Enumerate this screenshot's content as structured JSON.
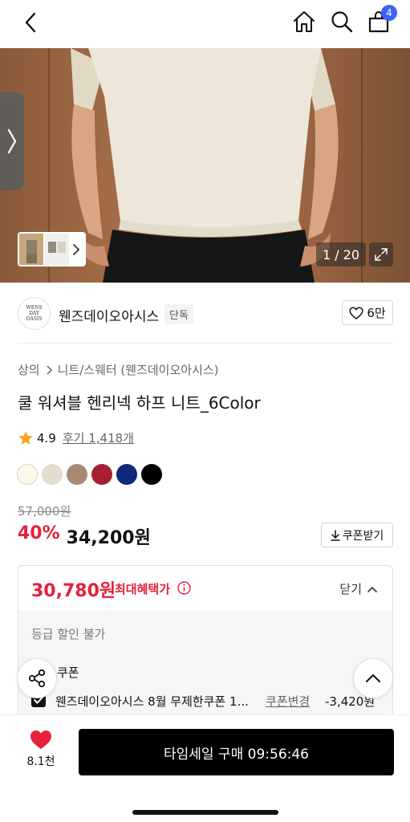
{
  "header": {
    "cart_count": "4",
    "icons": [
      "back-icon",
      "home-icon",
      "search-icon",
      "bag-icon"
    ]
  },
  "gallery": {
    "counter": "1 / 20",
    "colors": {
      "wall": "#a06a45",
      "shirt": "#ebe6d8",
      "pants": "#1a1a1a"
    }
  },
  "brand": {
    "logo_text": "WENS DAY OASIS",
    "name": "웬즈데이오아시스",
    "tag": "단독",
    "likes": "6만"
  },
  "product": {
    "breadcrumb": [
      "상의",
      "니트/스웨터 (웬즈데이오아시스)"
    ],
    "title": "쿨 워셔블 헨리넥 하프 니트_6Color",
    "rating": "4.9",
    "reviews": "후기 1,418개",
    "swatches": [
      "#fbfae8",
      "#e4ddcc",
      "#a68b73",
      "#a81f35",
      "#0e2a78",
      "#000000"
    ],
    "original_price": "57,000원",
    "discount": "40%",
    "price": "34,200원",
    "coupon_download": "쿠폰받기"
  },
  "benefit": {
    "max_price": "30,780원",
    "max_label": "최대혜택가",
    "close_label": "닫기",
    "grade_text": "등급 할인 불가",
    "coupon_label": "쿠폰",
    "coupon_name": "웬즈데이오아시스 8월 무제한쿠폰 1...",
    "coupon_change": "쿠폰변경",
    "coupon_amount": "-3,420원"
  },
  "bottom": {
    "heart_count": "8.1천",
    "buy_label": "타임세일 구매 09:56:46"
  },
  "theme": {
    "accent_red": "#e5213b",
    "badge_blue": "#3b63f5"
  }
}
